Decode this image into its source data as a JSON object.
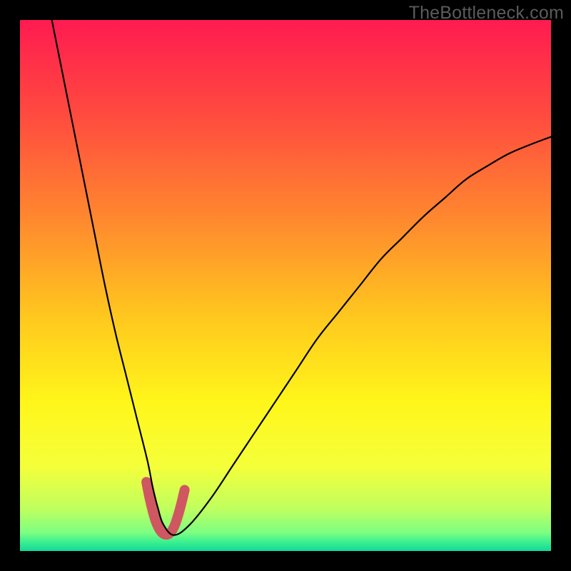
{
  "watermark": "TheBottleneck.com",
  "chart_data": {
    "type": "line",
    "title": "",
    "xlabel": "",
    "ylabel": "",
    "xlim": [
      0,
      100
    ],
    "ylim": [
      0,
      100
    ],
    "legend": false,
    "grid": false,
    "series": [
      {
        "name": "primary-curve",
        "color": "#000000",
        "x": [
          6,
          8,
          10,
          12,
          14,
          16,
          18,
          20,
          22,
          24,
          25,
          26,
          27,
          29,
          32,
          36,
          40,
          44,
          48,
          52,
          56,
          60,
          64,
          68,
          72,
          76,
          80,
          84,
          88,
          92,
          96,
          100
        ],
        "y": [
          100,
          90,
          80,
          70,
          60,
          50,
          41,
          33,
          25,
          17,
          12,
          8,
          5,
          3,
          5,
          10,
          16,
          22,
          28,
          34,
          40,
          45,
          50,
          55,
          59,
          63,
          66.5,
          70,
          72.5,
          74.8,
          76.5,
          78
        ]
      },
      {
        "name": "highlight-band",
        "color": "#cf5761",
        "x": [
          23.8,
          24.4,
          25.0,
          25.6,
          26.2,
          26.8,
          27.4,
          28.0,
          28.6,
          29.2,
          29.8,
          30.4,
          31.0
        ],
        "y": [
          13.0,
          10.0,
          7.5,
          5.5,
          4.2,
          3.4,
          3.1,
          3.2,
          3.8,
          5.0,
          6.8,
          9.0,
          11.5
        ]
      }
    ],
    "background_gradient": {
      "stops": [
        {
          "offset": 0.0,
          "color": "#ff1b50"
        },
        {
          "offset": 0.18,
          "color": "#ff4b3f"
        },
        {
          "offset": 0.38,
          "color": "#ff8a2e"
        },
        {
          "offset": 0.56,
          "color": "#ffc81e"
        },
        {
          "offset": 0.72,
          "color": "#fff61a"
        },
        {
          "offset": 0.84,
          "color": "#f5ff3a"
        },
        {
          "offset": 0.92,
          "color": "#c0ff5e"
        },
        {
          "offset": 0.965,
          "color": "#7dff82"
        },
        {
          "offset": 0.985,
          "color": "#35ee91"
        },
        {
          "offset": 1.0,
          "color": "#15d79a"
        }
      ]
    }
  }
}
